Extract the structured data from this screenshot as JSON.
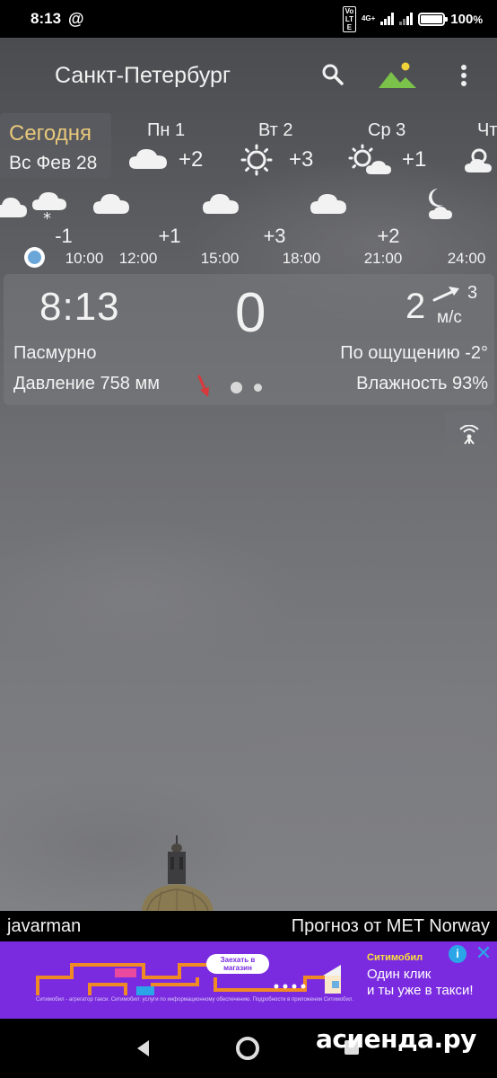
{
  "status_bar": {
    "time": "8:13",
    "at_symbol": "@",
    "volte": "Vo LTE",
    "network": "4G+",
    "battery": "100",
    "battery_unit": "%"
  },
  "header": {
    "city": "Санкт-Петербург",
    "search_icon": "search-icon",
    "landscape_icon": "landscape-icon",
    "menu_icon": "more-vert-icon"
  },
  "days": {
    "today": {
      "title": "Сегодня",
      "date": "Вс Фев 28"
    },
    "items": [
      {
        "label": "Пн 1",
        "temp": "+2",
        "icon": "cloud-icon"
      },
      {
        "label": "Вт 2",
        "temp": "+3",
        "icon": "sun-icon"
      },
      {
        "label": "Ср 3",
        "temp": "+1",
        "icon": "sun-cloud-icon"
      },
      {
        "label": "Чт",
        "temp": "",
        "icon": "cloud-icon"
      }
    ]
  },
  "hourly": {
    "temps": [
      "-1",
      "+1",
      "+3",
      "+2"
    ],
    "times": [
      "10:00",
      "12:00",
      "15:00",
      "18:00",
      "21:00",
      "24:00"
    ]
  },
  "current": {
    "time": "8:13",
    "temp": "0",
    "wind_speed": "2",
    "wind_gust": "3",
    "wind_unit": "м/с",
    "condition": "Пасмурно",
    "feels_like": "По ощущению -2°",
    "pressure": "Давление 758 мм",
    "humidity": "Влажность 93%"
  },
  "footer": {
    "author": "javarman",
    "source": "Прогноз от MET Norway"
  },
  "ad": {
    "brand": "Ситимобил",
    "text_line1": "Один клик",
    "text_line2": "и ты уже в такси!",
    "bubble": "Заехать в магазин",
    "info": "i",
    "close": "✕",
    "disclaimer": "Ситимобил - агрегатор такси. Ситимобил: услуги по информационному обеспечению. Подробности в приложении Ситимобил."
  },
  "watermark": "асиенда.ру",
  "colors": {
    "today_title": "#e8c87a",
    "pressure_arrow": "#d9393a",
    "now_dot": "#6ba6d9",
    "ad_bg": "#7a2be0",
    "ad_accent": "#f6e13a"
  }
}
